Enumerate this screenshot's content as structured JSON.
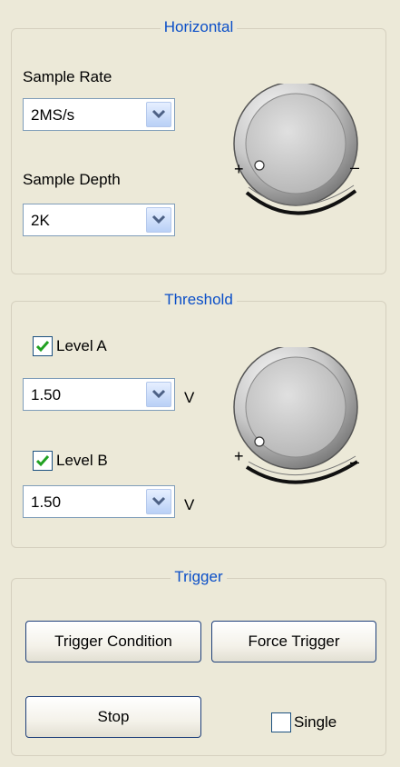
{
  "horizontal": {
    "title": "Horizontal",
    "sample_rate": {
      "label": "Sample Rate",
      "value": "2MS/s"
    },
    "sample_depth": {
      "label": "Sample Depth",
      "value": "2K"
    },
    "knob": {
      "plus": "+",
      "minus": "–"
    }
  },
  "threshold": {
    "title": "Threshold",
    "level_a": {
      "label": "Level A",
      "checked": true,
      "value": "1.50",
      "unit": "V"
    },
    "level_b": {
      "label": "Level B",
      "checked": true,
      "value": "1.50",
      "unit": "V"
    },
    "knob": {
      "plus": "+",
      "minus": "–"
    }
  },
  "trigger": {
    "title": "Trigger",
    "trigger_condition_label": "Trigger Condition",
    "force_trigger_label": "Force Trigger",
    "stop_label": "Stop",
    "single": {
      "label": "Single",
      "checked": false
    }
  },
  "icons": {
    "dropdown": "chevron-down-icon",
    "check": "checkmark-icon",
    "knob": "rotary-knob-icon"
  },
  "colors": {
    "background": "#ece9d8",
    "group_title": "#0b4fc8",
    "group_border": "#d5d0bf",
    "combo_border": "#7f9db9",
    "checkmark": "#21a121"
  }
}
